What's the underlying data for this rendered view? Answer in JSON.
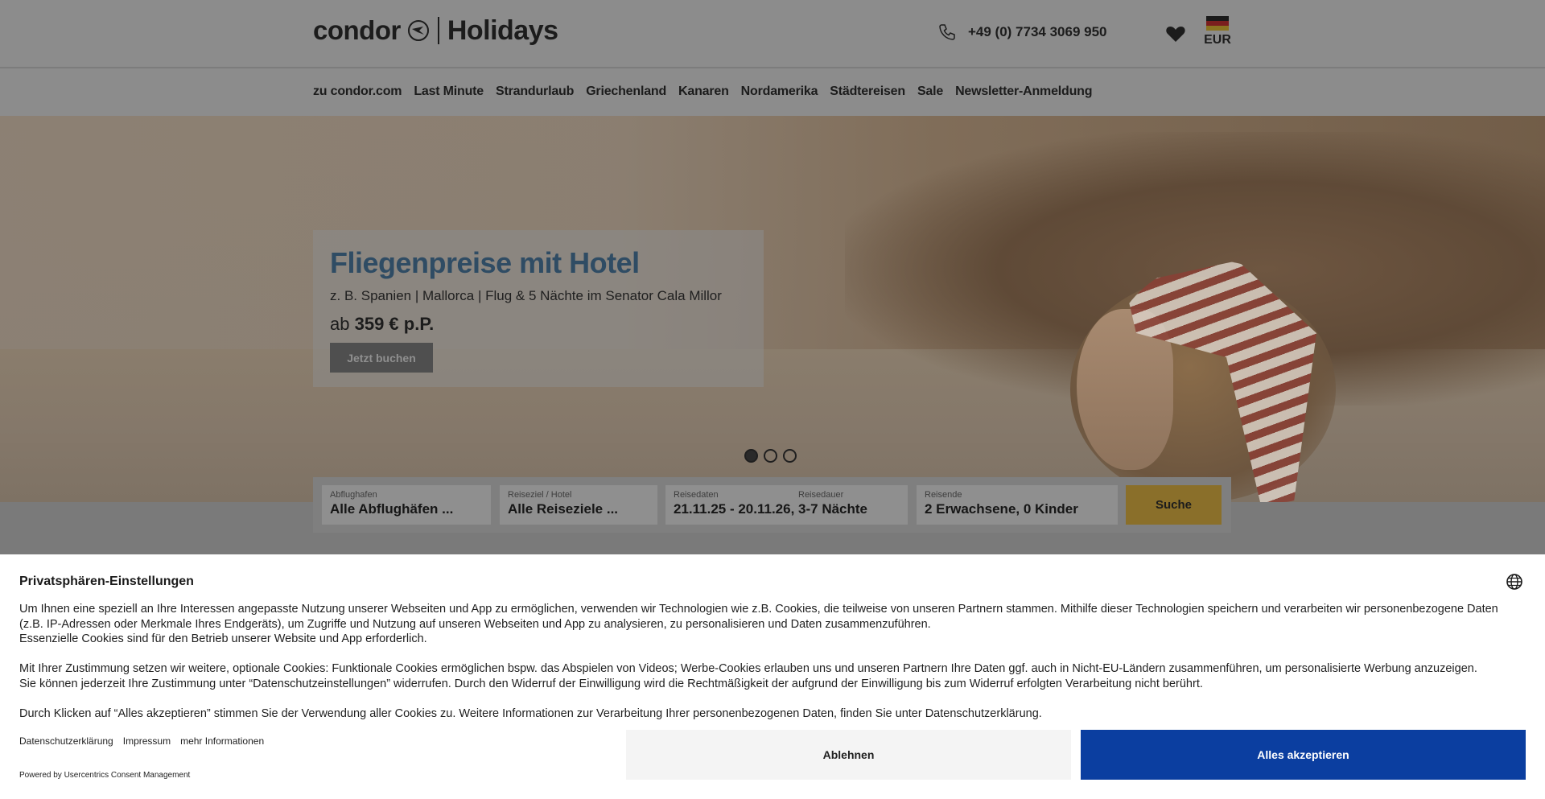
{
  "header": {
    "logo_brand": "condor",
    "logo_product": "Holidays",
    "phone": "+49 (0) 7734 3069 950",
    "currency": "EUR"
  },
  "nav": {
    "items": [
      "zu condor.com",
      "Last Minute",
      "Strandurlaub",
      "Griechenland",
      "Kanaren",
      "Nordamerika",
      "Städtereisen",
      "Sale",
      "Newsletter-Anmeldung"
    ]
  },
  "promo": {
    "title": "Fliegenpreise mit Hotel",
    "subtitle": "z. B. Spanien | Mallorca | Flug & 5 Nächte im Senator Cala Millor",
    "price_prefix": "ab",
    "price": "359 € p.P.",
    "button": "Jetzt buchen"
  },
  "carousel": {
    "slides": 3,
    "active": 1
  },
  "search": {
    "departure_label": "Abflughafen",
    "departure_value": "Alle Abflughäfen ...",
    "destination_label": "Reiseziel / Hotel",
    "destination_value": "Alle Reiseziele ...",
    "dates_label": "Reisedaten",
    "duration_label": "Reisedauer",
    "dates_value": "21.11.25 - 20.11.26, 3-7 Nächte",
    "travellers_label": "Reisende",
    "travellers_value": "2 Erwachsene, 0 Kinder",
    "button": "Suche"
  },
  "cookie": {
    "title": "Privatsphären-Einstellungen",
    "para1_line1": "Um Ihnen eine speziell an Ihre Interessen angepasste Nutzung unserer Webseiten und App zu ermöglichen, verwenden wir Technologien wie z.B. Cookies, die teilweise von unseren Partnern stammen. Mithilfe dieser Technologien speichern und verarbeiten wir personenbezogene Daten (z.B. IP-Adressen oder Merkmale Ihres Endgeräts), um Zugriffe und Nutzung auf unseren Webseiten und App zu analysieren, zu personalisieren und Daten zusammenzuführen.",
    "para1_line2": "Essenzielle Cookies sind für den Betrieb unserer Website und App erforderlich.",
    "para2_line1": "Mit Ihrer Zustimmung setzen wir weitere, optionale Cookies: Funktionale Cookies ermöglichen bspw. das Abspielen von Videos; Werbe-Cookies erlauben uns und unseren Partnern Ihre Daten ggf. auch in Nicht-EU-Ländern zusammenführen, um personalisierte Werbung anzuzeigen.",
    "para2_line2": "Sie können jederzeit Ihre Zustimmung unter “Datenschutzeinstellungen” widerrufen. Durch den Widerruf der Einwilligung wird die Rechtmäßigkeit der aufgrund der Einwilligung bis zum Widerruf erfolgten Verarbeitung nicht berührt.",
    "para3": "Durch Klicken auf “Alles akzeptieren” stimmen Sie der Verwendung aller Cookies zu. Weitere Informationen zur Verarbeitung Ihrer personenbezogenen Daten, finden Sie unter Datenschutzerklärung.",
    "link_privacy": "Datenschutzerklärung",
    "link_imprint": "Impressum",
    "link_more": "mehr Informationen",
    "powered_by": "Powered by Usercentrics Consent Management",
    "btn_decline": "Ablehnen",
    "btn_accept": "Alles akzeptieren"
  },
  "colors": {
    "accept_button": "#0b3ea0",
    "promo_title": "#2f4c64",
    "search_button": "#8a6f2a"
  }
}
